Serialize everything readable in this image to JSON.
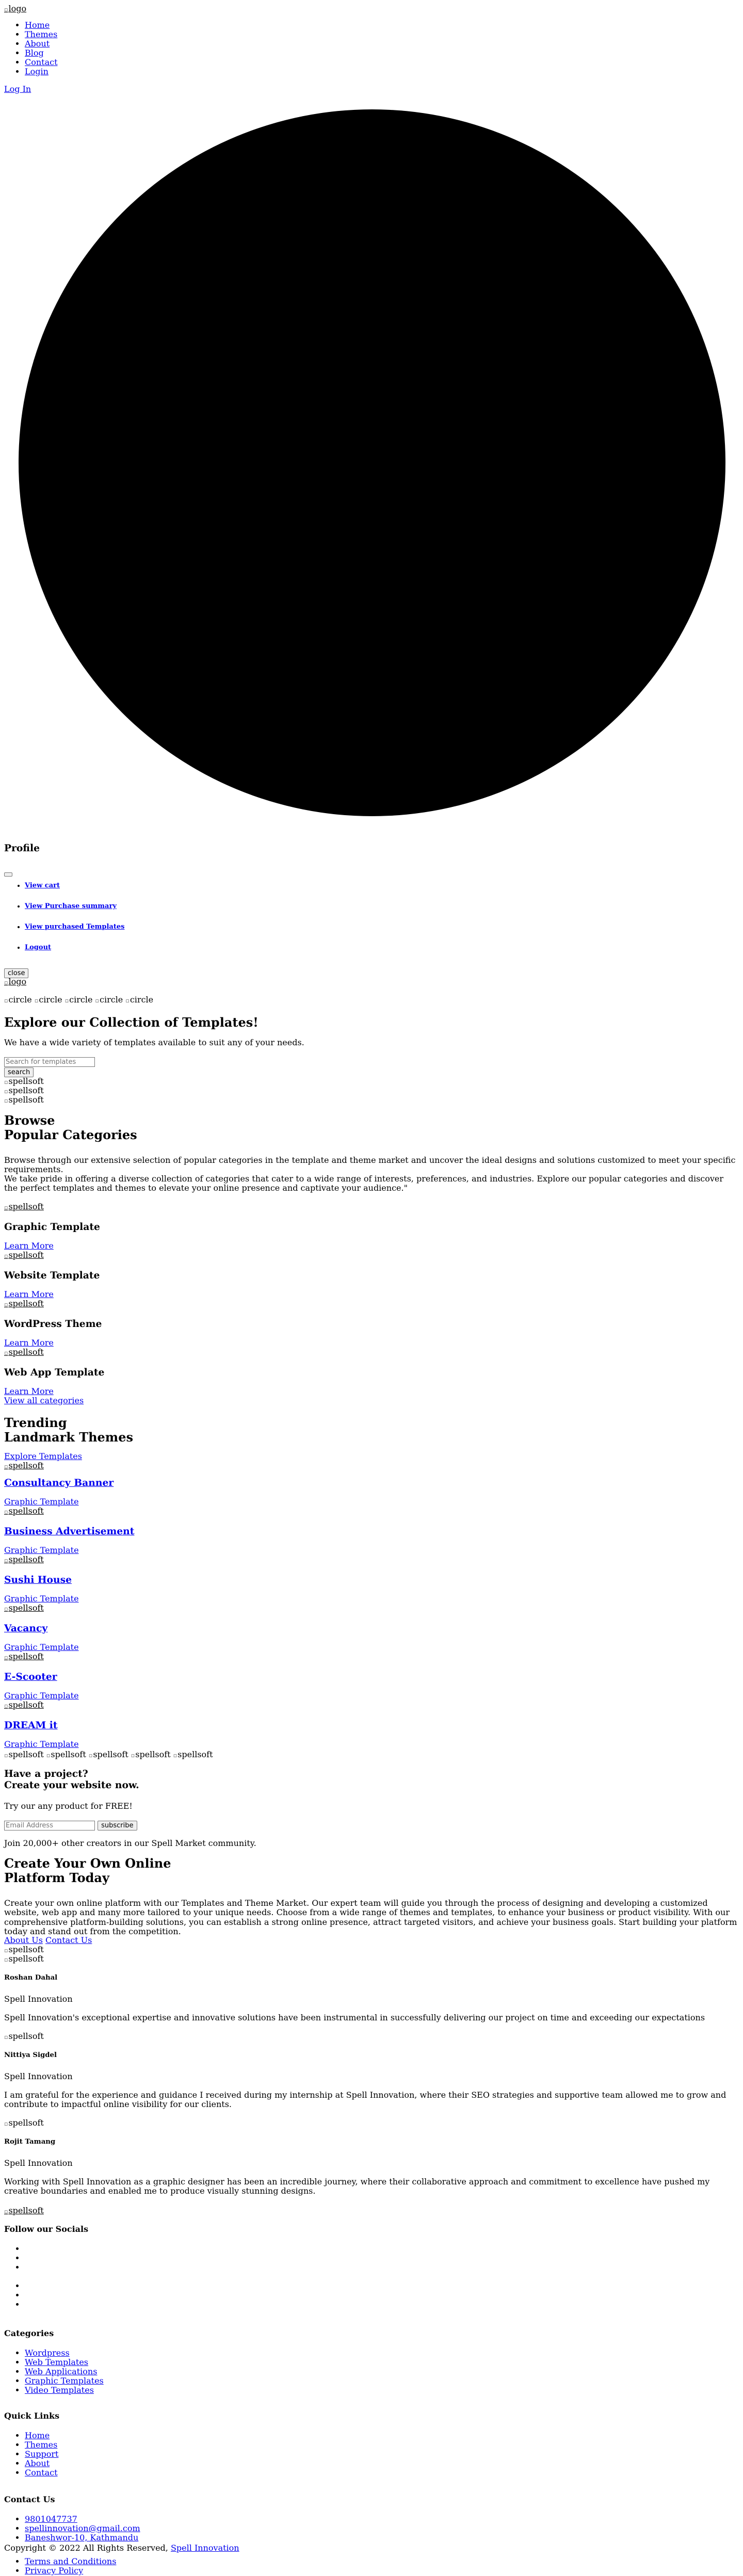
{
  "header": {
    "logo_alt": "logo",
    "nav": [
      "Home",
      "Themes",
      "About",
      "Blog",
      "Contact",
      "Login"
    ],
    "login_link": "Log In"
  },
  "profile": {
    "title": "Profile",
    "items": [
      "View cart",
      "View Purchase summary",
      "View purchased Templates",
      "Logout"
    ],
    "close_label": "close",
    "logo_alt": "logo"
  },
  "hero": {
    "circle_alt": "circle",
    "title": "Explore our Collection of Templates!",
    "subtitle": "We have a wide variety of templates available to suit any of your needs.",
    "search_placeholder": "Search for templates",
    "search_button": "search",
    "image_alt": "spellsoft"
  },
  "categories": {
    "title_line1": "Browse",
    "title_line2": "Popular Categories",
    "desc1": "Browse through our extensive selection of popular categories in the template and theme market and uncover the ideal designs and solutions customized to meet your specific requirements.",
    "desc2": "We take pride in offering a diverse collection of categories that cater to a wide range of interests, preferences, and industries. Explore our popular categories and discover the perfect templates and themes to elevate your online presence and captivate your audience.\"",
    "image_alt": "spellsoft",
    "items": [
      {
        "name": "Graphic Template",
        "link": "Learn More"
      },
      {
        "name": "Website Template",
        "link": "Learn More"
      },
      {
        "name": "WordPress Theme",
        "link": "Learn More"
      },
      {
        "name": "Web App Template",
        "link": "Learn More"
      }
    ],
    "view_all": "View all categories"
  },
  "trending": {
    "title_line1": "Trending",
    "title_line2": "Landmark Themes",
    "explore": "Explore Templates",
    "image_alt": "spellsoft",
    "items": [
      {
        "name": "Consultancy Banner",
        "category": "Graphic Template"
      },
      {
        "name": "Business Advertisement",
        "category": "Graphic Template"
      },
      {
        "name": "Sushi House",
        "category": "Graphic Template"
      },
      {
        "name": "Vacancy",
        "category": "Graphic Template"
      },
      {
        "name": "E-Scooter",
        "category": "Graphic Template"
      },
      {
        "name": "DREAM it",
        "category": "Graphic Template"
      }
    ]
  },
  "project": {
    "image_alt": "spellsoft",
    "title_line1": "Have a project?",
    "title_line2": "Create your website now.",
    "subtitle": "Try our any product for FREE!",
    "email_placeholder": "Email Address",
    "subscribe": "subscribe",
    "join": "Join 20,000+ other creators in our Spell Market community."
  },
  "platform": {
    "title_line1": "Create Your Own Online",
    "title_line2": "Platform Today",
    "desc": "Create your own online platform with our Templates and Theme Market. Our expert team will guide you through the process of designing and developing a customized website, web app and many more tailored to your unique needs. Choose from a wide range of themes and templates, to enhance your business or product visibility. With our comprehensive platform-building solutions, you can establish a strong online presence, attract targeted visitors, and achieve your business goals. Start building your platform today and stand out from the competition.",
    "about": "About Us",
    "contact": "Contact Us",
    "image_alt": "spellsoft"
  },
  "testimonials": [
    {
      "name": "Roshan Dahal",
      "company": "Spell Innovation",
      "text": "Spell Innovation's exceptional expertise and innovative solutions have been instrumental in successfully delivering our project on time and exceeding our expectations"
    },
    {
      "name": "Nittiya Sigdel",
      "company": "Spell Innovation",
      "text": "I am grateful for the experience and guidance I received during my internship at Spell Innovation, where their SEO strategies and supportive team allowed me to grow and contribute to impactful online visibility for our clients."
    },
    {
      "name": "Rojit Tamang",
      "company": "Spell Innovation",
      "text": "Working with Spell Innovation as a graphic designer has been an incredible journey, where their collaborative approach and commitment to excellence have pushed my creative boundaries and enabled me to produce visually stunning designs."
    }
  ],
  "footer": {
    "logo_alt": "spellsoft",
    "socials_title": "Follow our Socials",
    "categories_title": "Categories",
    "categories": [
      "Wordpress",
      "Web Templates",
      "Web Applications",
      "Graphic Templates",
      "Video Templates"
    ],
    "quick_title": "Quick Links",
    "quick": [
      "Home",
      "Themes",
      "Support",
      "About",
      "Contact"
    ],
    "contact_title": "Contact Us",
    "phone": "9801047737",
    "email": "spellinnovation@gmail.com",
    "address": "Baneshwor-10, Kathmandu",
    "copyright": "Copyright © 2022 All Rights Reserved,",
    "company": "Spell Innovation",
    "terms": "Terms and Conditions",
    "privacy": "Privacy Policy"
  }
}
